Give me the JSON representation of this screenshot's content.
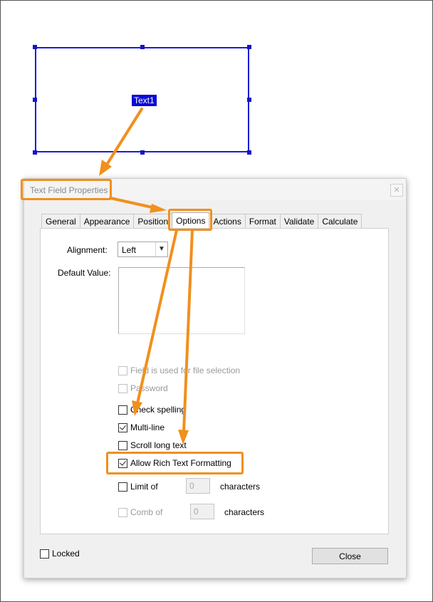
{
  "page": {
    "field_name": "Text1"
  },
  "dialog": {
    "title": "Text Field Properties",
    "close_icon": "close-x-icon",
    "tabs": [
      "General",
      "Appearance",
      "Position",
      "Options",
      "Actions",
      "Format",
      "Validate",
      "Calculate"
    ],
    "active_tab": "Options",
    "options": {
      "alignment_label": "Alignment:",
      "alignment_value": "Left",
      "default_value_label": "Default Value:",
      "default_value": "",
      "file_selection": {
        "label": "Field is used for file selection",
        "checked": false,
        "enabled": false
      },
      "password": {
        "label": "Password",
        "checked": false,
        "enabled": false
      },
      "check_spelling": {
        "label": "Check spelling",
        "checked": false,
        "enabled": true
      },
      "multi_line": {
        "label": "Multi-line",
        "checked": true,
        "enabled": true
      },
      "scroll_long_text": {
        "label": "Scroll long text",
        "checked": false,
        "enabled": true
      },
      "allow_rich_text": {
        "label": "Allow Rich Text Formatting",
        "checked": true,
        "enabled": true
      },
      "limit_of": {
        "label": "Limit of",
        "value": "0",
        "suffix": "characters",
        "checked": false,
        "enabled": true
      },
      "comb_of": {
        "label": "Comb of",
        "value": "0",
        "suffix": "characters",
        "checked": false,
        "enabled": false
      }
    },
    "locked_label": "Locked",
    "close_button": "Close"
  },
  "colors": {
    "annotation": "#f0901d",
    "selection": "#1c1cd6"
  }
}
